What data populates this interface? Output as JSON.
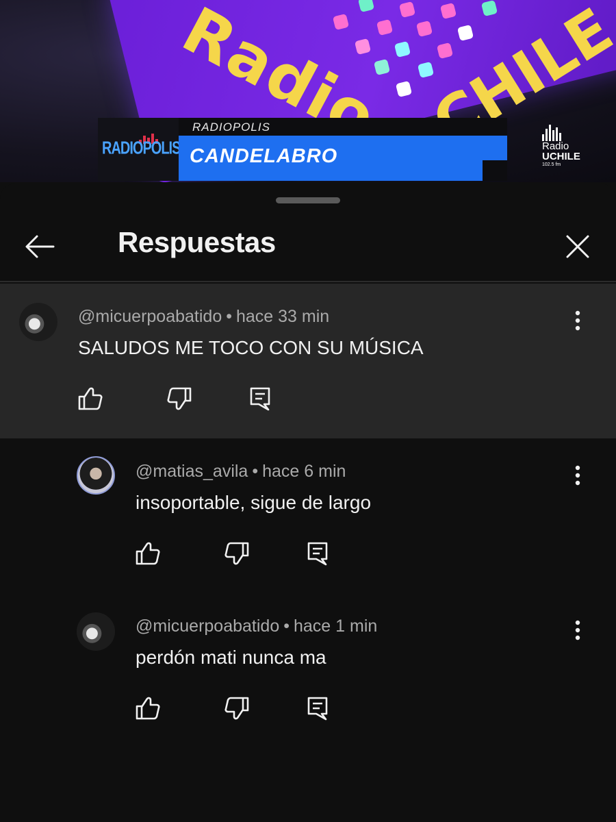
{
  "video": {
    "brand_big": "Radio",
    "brand_big_2": "CHILE",
    "lower_third_kicker": "RADIOPOLIS",
    "lower_third_headline": "CANDELABRO",
    "lower_third_logo": "RADIOPOLIS",
    "corner_logo": {
      "line1": "Radio",
      "line2": "UCHILE",
      "line3": "102.5 fm"
    }
  },
  "panel": {
    "title": "Respuestas",
    "back_icon": "arrow-left-icon",
    "close_icon": "close-icon"
  },
  "comments": [
    {
      "author": "@micuerpoabatido",
      "separator": "•",
      "time": "hace 33 min",
      "text": "SALUDOS ME TOCO CON SU MÚSICA"
    },
    {
      "author": "@matias_avila",
      "separator": "•",
      "time": "hace 6 min",
      "text": "insoportable, sigue de largo"
    },
    {
      "author": "@micuerpoabatido",
      "separator": "•",
      "time": "hace 1 min",
      "text": "perdón mati nunca ma"
    }
  ],
  "icons": {
    "like": "thumb-up-icon",
    "dislike": "thumb-down-icon",
    "reply": "reply-icon",
    "more": "more-vertical-icon"
  },
  "colors": {
    "background": "#0f0f0f",
    "highlight": "#272727",
    "text": "#f1f1f1",
    "meta": "#aaaaaa",
    "video_purple": "#6b1fd8",
    "video_yellow": "#f5d64a",
    "lower_third_blue": "#1e6ff0"
  }
}
